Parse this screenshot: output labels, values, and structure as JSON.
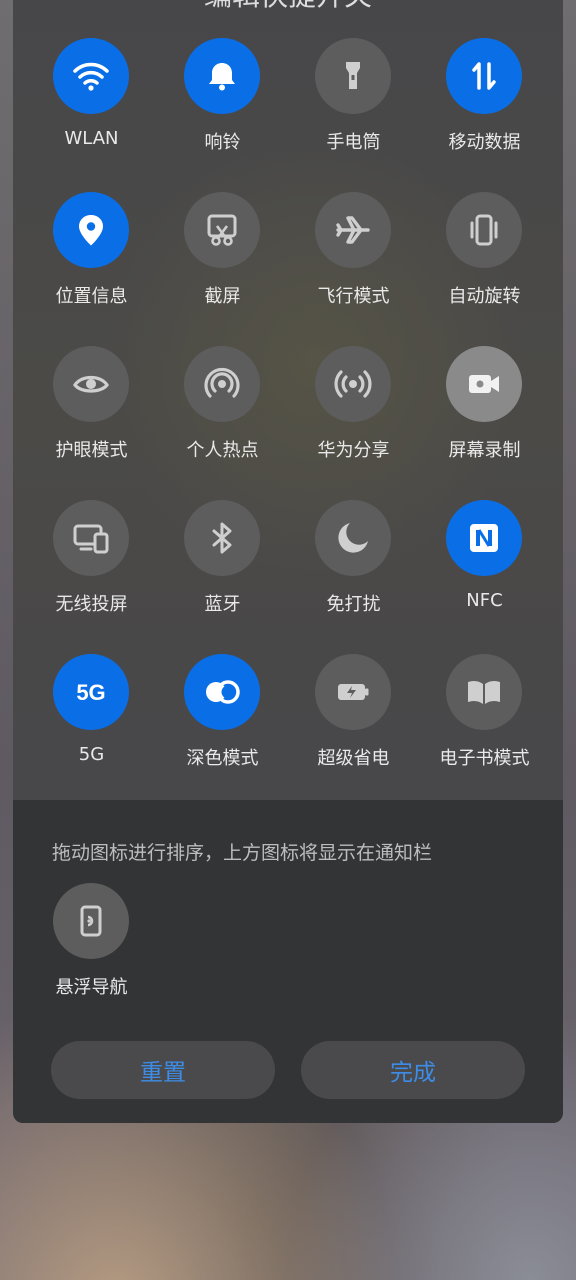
{
  "header": {
    "title": "编辑快捷开关",
    "back_icon": "arrow-back-icon"
  },
  "active_color": "#0a6fe6",
  "tiles": [
    {
      "label": "WLAN",
      "icon": "wifi-icon",
      "state": "on"
    },
    {
      "label": "响铃",
      "icon": "bell-icon",
      "state": "on"
    },
    {
      "label": "手电筒",
      "icon": "flashlight-icon",
      "state": "off"
    },
    {
      "label": "移动数据",
      "icon": "mobile-data-icon",
      "state": "on"
    },
    {
      "label": "位置信息",
      "icon": "location-icon",
      "state": "on"
    },
    {
      "label": "截屏",
      "icon": "screenshot-icon",
      "state": "off"
    },
    {
      "label": "飞行模式",
      "icon": "airplane-icon",
      "state": "off"
    },
    {
      "label": "自动旋转",
      "icon": "rotate-icon",
      "state": "off"
    },
    {
      "label": "护眼模式",
      "icon": "eye-icon",
      "state": "off"
    },
    {
      "label": "个人热点",
      "icon": "hotspot-icon",
      "state": "off"
    },
    {
      "label": "华为分享",
      "icon": "share-icon",
      "state": "off"
    },
    {
      "label": "屏幕录制",
      "icon": "video-icon",
      "state": "highlight"
    },
    {
      "label": "无线投屏",
      "icon": "cast-icon",
      "state": "off"
    },
    {
      "label": "蓝牙",
      "icon": "bluetooth-icon",
      "state": "off"
    },
    {
      "label": "免打扰",
      "icon": "moon-icon",
      "state": "off"
    },
    {
      "label": "NFC",
      "icon": "nfc-icon",
      "state": "on"
    },
    {
      "label": "5G",
      "icon": "5g-icon",
      "state": "on"
    },
    {
      "label": "深色模式",
      "icon": "dark-mode-icon",
      "state": "on"
    },
    {
      "label": "超级省电",
      "icon": "battery-icon",
      "state": "off"
    },
    {
      "label": "电子书模式",
      "icon": "book-icon",
      "state": "off"
    }
  ],
  "inactive_hint": "拖动图标进行排序，上方图标将显示在通知栏",
  "inactive_tiles": [
    {
      "label": "悬浮导航",
      "icon": "floating-nav-icon",
      "state": "off"
    }
  ],
  "buttons": {
    "reset": "重置",
    "done": "完成"
  }
}
